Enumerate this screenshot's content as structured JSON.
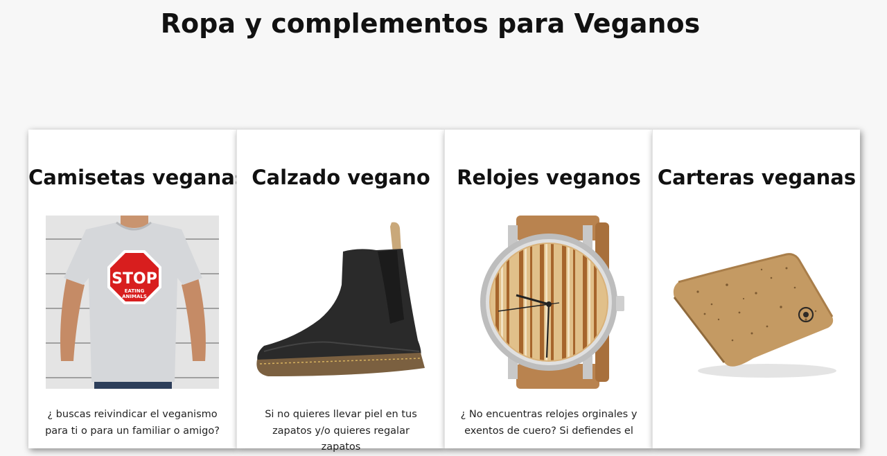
{
  "page": {
    "title": "Ropa y complementos para Veganos"
  },
  "cards": [
    {
      "title": "Camisetas veganas",
      "image_icon": "vegan-tshirt-image",
      "shirt_text_main": "STOP",
      "shirt_text_sub1": "EATING",
      "shirt_text_sub2": "ANIMALS",
      "description": "¿ buscas reivindicar el veganismo para ti o para un familiar o amigo?"
    },
    {
      "title": "Calzado vegano",
      "image_icon": "vegan-boot-image",
      "description": "Si no quieres llevar piel en tus zapatos y/o quieres regalar zapatos"
    },
    {
      "title": "Relojes veganos",
      "image_icon": "wooden-watch-image",
      "description": "¿ No encuentras relojes orginales y exentos de cuero? Si defiendes el"
    },
    {
      "title": "Carteras veganas",
      "image_icon": "cork-wallet-image",
      "description": ""
    }
  ],
  "colors": {
    "background": "#f7f7f7",
    "card": "#ffffff",
    "text": "#111111",
    "stop_sign": "#d81e1e",
    "cork": "#c49a63"
  }
}
